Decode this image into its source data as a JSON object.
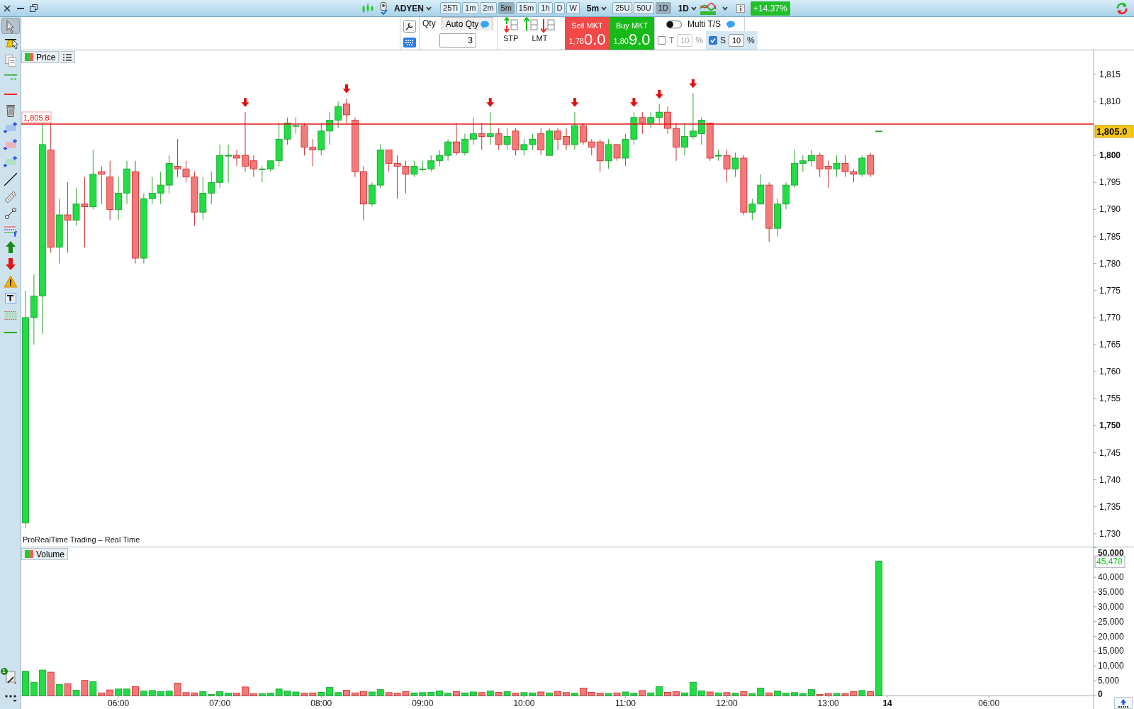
{
  "toolbar": {
    "instrument": "ADYEN",
    "intervals": [
      {
        "label": "25Ti",
        "selected": false
      },
      {
        "label": "1m",
        "selected": false
      },
      {
        "label": "2m",
        "selected": false
      },
      {
        "label": "5m",
        "selected": true
      },
      {
        "label": "15m",
        "selected": false
      },
      {
        "label": "1h",
        "selected": false
      },
      {
        "label": "D",
        "selected": false
      },
      {
        "label": "W",
        "selected": false
      }
    ],
    "interval_menu": "5m",
    "units": [
      {
        "label": "25U",
        "selected": false
      },
      {
        "label": "50U",
        "selected": false
      },
      {
        "label": "1D",
        "selected": true
      }
    ],
    "period_menu": "1D",
    "change": "+14.37%"
  },
  "order_panel": {
    "qty_label": "Qty",
    "auto_qty_label": "Auto Qty",
    "qty_value": "3",
    "stop_label": "STP",
    "limit_label": "LMT",
    "sell": {
      "label": "Sell MKT",
      "price_prefix": "1,78",
      "price_main": "0.0"
    },
    "buy": {
      "label": "Buy MKT",
      "price_prefix": "1,80",
      "price_main": "9.0"
    },
    "multi_ts": {
      "label": "Multi T/S",
      "on": false
    },
    "trailing": {
      "label": "T",
      "checked": false,
      "value": "10",
      "unit": "%",
      "disabled": true
    },
    "stop": {
      "label": "S",
      "checked": true,
      "value": "10",
      "unit": "%",
      "disabled": false
    }
  },
  "sidebar": {
    "tools": [
      {
        "kind": "pointer",
        "selected": true
      },
      {
        "kind": "alert",
        "selected": false
      },
      {
        "kind": "copy",
        "selected": false
      },
      {
        "kind": "hlines",
        "selected": false
      },
      {
        "kind": "hline",
        "selected": false
      },
      {
        "kind": "trash",
        "selected": false
      },
      {
        "kind": "rect-blue",
        "selected": false
      },
      {
        "kind": "rect-red",
        "selected": false
      },
      {
        "kind": "rect-green",
        "selected": false
      },
      {
        "kind": "line",
        "selected": false
      },
      {
        "kind": "ruler",
        "selected": false
      },
      {
        "kind": "connector",
        "selected": false
      },
      {
        "kind": "levels",
        "selected": false
      },
      {
        "kind": "up",
        "selected": false
      },
      {
        "kind": "down",
        "selected": false
      },
      {
        "kind": "warning",
        "selected": false
      },
      {
        "kind": "text",
        "selected": false
      },
      {
        "kind": "pattern",
        "selected": false
      },
      {
        "kind": "green-line",
        "selected": false
      }
    ],
    "badge": "1"
  },
  "price_pane": {
    "legend": "Price",
    "source_label": "ProRealTime Trading – Real Time",
    "last_price": "1,805.0",
    "chart_data": {
      "type": "candlestick",
      "ylim": [
        1727.5,
        1819.43
      ],
      "yticks": [
        {
          "value": 1815,
          "label": "1,815"
        },
        {
          "value": 1810,
          "label": "1,810"
        },
        {
          "value": 1800,
          "label": "1,800"
        },
        {
          "value": 1795,
          "label": "1,795"
        },
        {
          "value": 1790,
          "label": "1,790"
        },
        {
          "value": 1785,
          "label": "1,785"
        },
        {
          "value": 1780,
          "label": "1,780"
        },
        {
          "value": 1775,
          "label": "1,775"
        },
        {
          "value": 1770,
          "label": "1,770"
        },
        {
          "value": 1765,
          "label": "1,765"
        },
        {
          "value": 1760,
          "label": "1,760"
        },
        {
          "value": 1755,
          "label": "1,755"
        },
        {
          "value": 1750,
          "label": "1,750"
        },
        {
          "value": 1745,
          "label": "1,745"
        },
        {
          "value": 1740,
          "label": "1,740"
        },
        {
          "value": 1735,
          "label": "1,735"
        },
        {
          "value": 1730,
          "label": "1,730"
        }
      ],
      "ohlc": [
        [
          1732,
          1775,
          1731,
          1770
        ],
        [
          1770,
          1778,
          1765,
          1774
        ],
        [
          1774,
          1806,
          1767,
          1802
        ],
        [
          1801,
          1806,
          1782,
          1783
        ],
        [
          1783,
          1792,
          1780,
          1789
        ],
        [
          1789,
          1795,
          1782,
          1788
        ],
        [
          1788,
          1794,
          1787,
          1791
        ],
        [
          1791,
          1796,
          1783,
          1790.5
        ],
        [
          1790.5,
          1801,
          1790,
          1796.5
        ],
        [
          1797,
          1798,
          1791,
          1796.5
        ],
        [
          1796,
          1799,
          1788,
          1790
        ],
        [
          1790,
          1796,
          1788,
          1793
        ],
        [
          1793,
          1799,
          1791,
          1797.5
        ],
        [
          1797,
          1799,
          1780,
          1781
        ],
        [
          1781,
          1793,
          1780,
          1792
        ],
        [
          1792,
          1796,
          1791,
          1793
        ],
        [
          1793,
          1797,
          1791,
          1794.5
        ],
        [
          1794.5,
          1800,
          1793,
          1798.5
        ],
        [
          1798,
          1803,
          1796,
          1797.5
        ],
        [
          1797.5,
          1799,
          1795,
          1796
        ],
        [
          1796,
          1797,
          1787,
          1789.5
        ],
        [
          1789.5,
          1796,
          1788,
          1793
        ],
        [
          1793,
          1797,
          1791,
          1795
        ],
        [
          1795,
          1802,
          1794,
          1800
        ],
        [
          1800,
          1802,
          1795,
          1800
        ],
        [
          1800,
          1801,
          1798,
          1799.5
        ],
        [
          1800,
          1808,
          1797,
          1798
        ],
        [
          1799,
          1800,
          1796,
          1797.5
        ],
        [
          1797.5,
          1798,
          1795,
          1797.5
        ],
        [
          1797.5,
          1799,
          1797,
          1799
        ],
        [
          1799,
          1806,
          1798,
          1803
        ],
        [
          1803,
          1807,
          1802,
          1806
        ],
        [
          1805.5,
          1807,
          1804,
          1805.5
        ],
        [
          1805.5,
          1806,
          1800,
          1801.5
        ],
        [
          1801.5,
          1803,
          1798,
          1801
        ],
        [
          1801,
          1806,
          1800,
          1804.5
        ],
        [
          1804.5,
          1808,
          1802,
          1806.5
        ],
        [
          1806.5,
          1810,
          1805,
          1809
        ],
        [
          1809.5,
          1810.5,
          1806,
          1807.5
        ],
        [
          1806.5,
          1807,
          1796,
          1797
        ],
        [
          1797,
          1798,
          1788,
          1791
        ],
        [
          1791,
          1795,
          1790.5,
          1794.5
        ],
        [
          1794.5,
          1802,
          1794,
          1801
        ],
        [
          1801,
          1801,
          1797,
          1798.5
        ],
        [
          1798.5,
          1800,
          1792,
          1798
        ],
        [
          1798,
          1799,
          1793,
          1796.5
        ],
        [
          1796.5,
          1799,
          1796,
          1798
        ],
        [
          1797.5,
          1799,
          1797,
          1797.5
        ],
        [
          1797.5,
          1800,
          1797,
          1799
        ],
        [
          1799,
          1801,
          1798,
          1800
        ],
        [
          1800,
          1803,
          1799,
          1802.5
        ],
        [
          1802.5,
          1806,
          1800,
          1800.5
        ],
        [
          1800.5,
          1804,
          1800,
          1803
        ],
        [
          1803,
          1807,
          1802,
          1804
        ],
        [
          1804,
          1806,
          1801,
          1803.5
        ],
        [
          1803.5,
          1808,
          1802,
          1804
        ],
        [
          1804,
          1805,
          1801,
          1802
        ],
        [
          1802,
          1805,
          1801,
          1803.5
        ],
        [
          1804.5,
          1805,
          1800,
          1801
        ],
        [
          1801,
          1803,
          1800,
          1802
        ],
        [
          1802,
          1804,
          1801,
          1803
        ],
        [
          1804,
          1805,
          1800,
          1801
        ],
        [
          1800,
          1805,
          1800,
          1804.5
        ],
        [
          1804.5,
          1805,
          1801,
          1803
        ],
        [
          1803.5,
          1805,
          1801,
          1802
        ],
        [
          1802,
          1808,
          1801,
          1805.5
        ],
        [
          1805.5,
          1806,
          1802,
          1802.5
        ],
        [
          1802.5,
          1803,
          1800,
          1801.5
        ],
        [
          1802.5,
          1803,
          1797,
          1799
        ],
        [
          1799,
          1803,
          1797.5,
          1802
        ],
        [
          1802,
          1802,
          1799,
          1799.5
        ],
        [
          1799.5,
          1804,
          1798,
          1803
        ],
        [
          1803,
          1808,
          1802,
          1807
        ],
        [
          1807,
          1808,
          1804,
          1806
        ],
        [
          1806,
          1808,
          1805,
          1807
        ],
        [
          1807,
          1809.5,
          1806,
          1808
        ],
        [
          1808,
          1809,
          1804,
          1805
        ],
        [
          1805,
          1806,
          1799,
          1801.5
        ],
        [
          1801.5,
          1806,
          1800,
          1803.5
        ],
        [
          1803.5,
          1811.5,
          1803,
          1804.5
        ],
        [
          1804,
          1807,
          1802,
          1806.5
        ],
        [
          1806,
          1806,
          1799,
          1799.5
        ],
        [
          1800,
          1801,
          1799,
          1800
        ],
        [
          1800,
          1801,
          1795,
          1797.5
        ],
        [
          1797.5,
          1800.5,
          1796,
          1799.5
        ],
        [
          1799.5,
          1800,
          1789,
          1789.5
        ],
        [
          1789.5,
          1792,
          1788,
          1791
        ],
        [
          1791,
          1796.5,
          1791,
          1794.5
        ],
        [
          1794.5,
          1795,
          1784,
          1786.5
        ],
        [
          1786.5,
          1792,
          1785,
          1791
        ],
        [
          1791,
          1795,
          1790,
          1794.5
        ],
        [
          1794.5,
          1801,
          1794,
          1798.5
        ],
        [
          1798.5,
          1800,
          1797,
          1799
        ],
        [
          1799,
          1801,
          1798,
          1800
        ],
        [
          1800,
          1800.5,
          1796,
          1797.5
        ],
        [
          1798,
          1799,
          1794,
          1797.5
        ],
        [
          1797.5,
          1800,
          1796,
          1798.5
        ],
        [
          1798.5,
          1800,
          1796,
          1797
        ],
        [
          1797,
          1797.5,
          1795,
          1796.5
        ],
        [
          1796.5,
          1800,
          1796,
          1799.5
        ],
        [
          1800,
          1800.5,
          1796,
          1796.5
        ],
        [
          1804.5,
          1804.5,
          1804.5,
          1804.5
        ],
        null,
        null,
        null,
        null,
        null,
        null,
        null,
        null,
        null,
        null,
        null,
        null,
        null,
        null,
        null,
        null,
        null,
        null,
        null,
        null,
        null,
        null,
        null,
        null,
        null
      ],
      "categories": [
        null,
        null,
        null,
        null,
        null,
        null,
        null,
        null,
        null,
        null,
        null,
        null,
        null,
        null,
        null,
        null,
        null,
        null,
        null,
        null,
        null,
        null,
        null,
        null,
        null,
        null,
        null,
        null,
        null,
        null,
        null,
        null,
        null,
        null,
        null,
        null,
        null,
        null,
        null,
        null,
        null,
        null,
        null,
        null,
        null,
        null,
        null,
        null,
        null,
        null,
        null,
        null,
        null,
        null,
        null,
        null,
        null,
        null,
        null,
        null,
        null,
        null,
        null,
        null,
        null,
        null,
        null,
        null,
        null,
        null,
        null,
        null,
        null,
        null,
        null,
        null,
        null,
        null,
        null,
        null,
        null,
        null,
        null,
        null,
        null,
        null,
        null,
        null,
        null,
        null,
        null,
        null,
        null,
        null,
        null,
        null,
        null,
        null,
        null,
        null,
        null,
        null,
        null,
        null,
        null,
        null,
        null,
        null,
        null,
        null,
        null,
        null,
        null,
        null,
        null,
        null,
        null,
        null,
        null,
        null,
        null,
        null,
        null,
        null,
        null,
        null,
        null
      ],
      "ref_lines": [
        {
          "axis": "y",
          "value": 1805.8,
          "label": "1,805.8"
        }
      ]
    },
    "sell_signals": [
      false,
      false,
      false,
      false,
      false,
      false,
      false,
      false,
      false,
      false,
      false,
      false,
      false,
      false,
      false,
      false,
      false,
      false,
      false,
      false,
      false,
      false,
      false,
      false,
      false,
      false,
      true,
      false,
      false,
      false,
      false,
      false,
      false,
      false,
      false,
      false,
      false,
      false,
      true,
      false,
      false,
      false,
      false,
      false,
      false,
      false,
      false,
      false,
      false,
      false,
      false,
      false,
      false,
      false,
      false,
      true,
      false,
      false,
      false,
      false,
      false,
      false,
      false,
      false,
      false,
      true,
      false,
      false,
      false,
      false,
      false,
      false,
      true,
      false,
      false,
      true,
      false,
      false,
      false,
      true,
      false,
      false,
      false,
      false,
      false,
      false,
      false,
      false,
      false,
      false,
      false,
      false,
      false,
      false,
      false,
      false,
      false,
      false,
      false,
      false,
      false,
      false
    ]
  },
  "volume_pane": {
    "last_volume": "45,478",
    "chart_data": {
      "type": "bar",
      "ylim": [
        0,
        50100
      ],
      "categories": [
        null,
        null,
        null,
        null,
        null,
        null,
        null,
        null,
        null,
        null,
        null,
        "06:00",
        null,
        null,
        null,
        null,
        null,
        null,
        null,
        null,
        null,
        null,
        null,
        "07:00",
        null,
        null,
        null,
        null,
        null,
        null,
        null,
        null,
        null,
        null,
        null,
        "08:00",
        null,
        null,
        null,
        null,
        null,
        null,
        null,
        null,
        null,
        null,
        null,
        "09:00",
        null,
        null,
        null,
        null,
        null,
        null,
        null,
        null,
        null,
        null,
        null,
        "10:00",
        null,
        null,
        null,
        null,
        null,
        null,
        null,
        null,
        null,
        null,
        null,
        "11:00",
        null,
        null,
        null,
        null,
        null,
        null,
        null,
        null,
        null,
        null,
        null,
        "12:00",
        null,
        null,
        null,
        null,
        null,
        null,
        null,
        null,
        null,
        null,
        null,
        "13:00",
        null,
        null,
        null,
        null,
        null,
        null,
        "14",
        null,
        null,
        null,
        null,
        null,
        null,
        null,
        null,
        null,
        null,
        null,
        "06:00",
        null,
        null,
        null,
        null,
        null,
        null,
        null,
        null,
        null,
        null,
        null,
        null
      ],
      "yticks": [
        {
          "value": 0,
          "label": "0"
        },
        {
          "value": 5000,
          "label": "5,000"
        },
        {
          "value": 10000,
          "label": "10,000"
        },
        {
          "value": 15000,
          "label": "15,000"
        },
        {
          "value": 20000,
          "label": "20,000"
        },
        {
          "value": 25000,
          "label": "25,000"
        },
        {
          "value": 30000,
          "label": "30,000"
        },
        {
          "value": 35000,
          "label": "35,000"
        },
        {
          "value": 40000,
          "label": "40,000"
        },
        {
          "value": 50000,
          "label": "50,000"
        }
      ],
      "series": [
        {
          "name": "Volume",
          "values": [
            8200,
            4500,
            8600,
            7900,
            3700,
            4000,
            1800,
            5100,
            4700,
            900,
            1900,
            2200,
            2200,
            3000,
            1500,
            1700,
            1300,
            1500,
            4200,
            1000,
            900,
            1300,
            400,
            1300,
            800,
            800,
            2900,
            600,
            600,
            800,
            2200,
            1500,
            1200,
            800,
            900,
            1100,
            2800,
            1000,
            1800,
            900,
            1400,
            1200,
            2000,
            1000,
            800,
            1300,
            900,
            1000,
            1100,
            1600,
            800,
            1400,
            900,
            1200,
            1000,
            1500,
            1100,
            1300,
            800,
            1000,
            900,
            1200,
            900,
            1400,
            1000,
            800,
            2500,
            1100,
            800,
            700,
            900,
            1200,
            800,
            1700,
            900,
            3000,
            1100,
            1300,
            900,
            4500,
            1600,
            1200,
            900,
            1000,
            800,
            1300,
            700,
            2500,
            900,
            1500,
            800,
            1000,
            700,
            2000,
            400,
            700,
            700,
            700,
            1300,
            1700,
            1300,
            45478,
            null,
            null,
            null,
            null,
            null,
            null,
            null,
            null,
            null,
            null,
            null,
            null,
            null,
            null,
            null,
            null,
            null,
            null,
            null,
            null,
            null,
            null,
            null,
            null,
            null
          ]
        }
      ]
    }
  }
}
